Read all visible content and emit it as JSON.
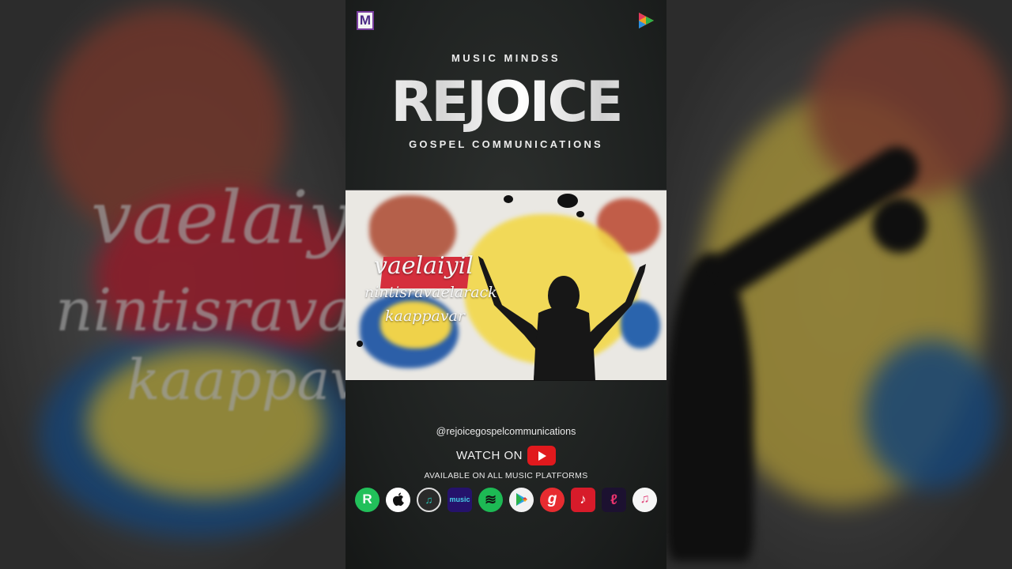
{
  "poster": {
    "brand_top": "MUSIC MINDSS",
    "brand_main": "REJOICE",
    "brand_sub": "GOSPEL COMMUNICATIONS",
    "logo_letter": "M"
  },
  "thumbnail": {
    "line1": "vaelaiyil",
    "line2": "nintisravaelarack",
    "line3": "kaappavar"
  },
  "footer": {
    "handle": "@rejoicegospelcommunications",
    "watch_label": "WATCH ON",
    "available_label": "AVAILABLE ON ALL MUSIC PLATFORMS"
  },
  "platforms": [
    {
      "name": "resso-icon",
      "glyph": "R",
      "bg": "#22c05a"
    },
    {
      "name": "apple-icon",
      "glyph": "",
      "bg": "#ffffff"
    },
    {
      "name": "jiosaavn-icon",
      "glyph": "♫",
      "bg": "#2a2a2a"
    },
    {
      "name": "amazon-music-icon",
      "glyph": "music",
      "bg": "#25126b"
    },
    {
      "name": "spotify-icon",
      "glyph": "≋",
      "bg": "#1db954"
    },
    {
      "name": "google-play-icon",
      "glyph": "▶",
      "bg": "#f2f2f2"
    },
    {
      "name": "gaana-icon",
      "glyph": "g",
      "bg": "#e72c30"
    },
    {
      "name": "wynk-icon",
      "glyph": "♪",
      "bg": "#d71b2a"
    },
    {
      "name": "hungama-icon",
      "glyph": "ℓ",
      "bg": "#1c1130"
    },
    {
      "name": "itunes-icon",
      "glyph": "♫",
      "bg": "#f6f6f6"
    }
  ],
  "colors": {
    "accent_red": "#e1191d",
    "poster_bg": "#1d201f"
  },
  "backdrop": {
    "left_text_1": "vaelaiyi",
    "left_text_2": "nintisravaela",
    "left_text_3": "kaappava"
  }
}
